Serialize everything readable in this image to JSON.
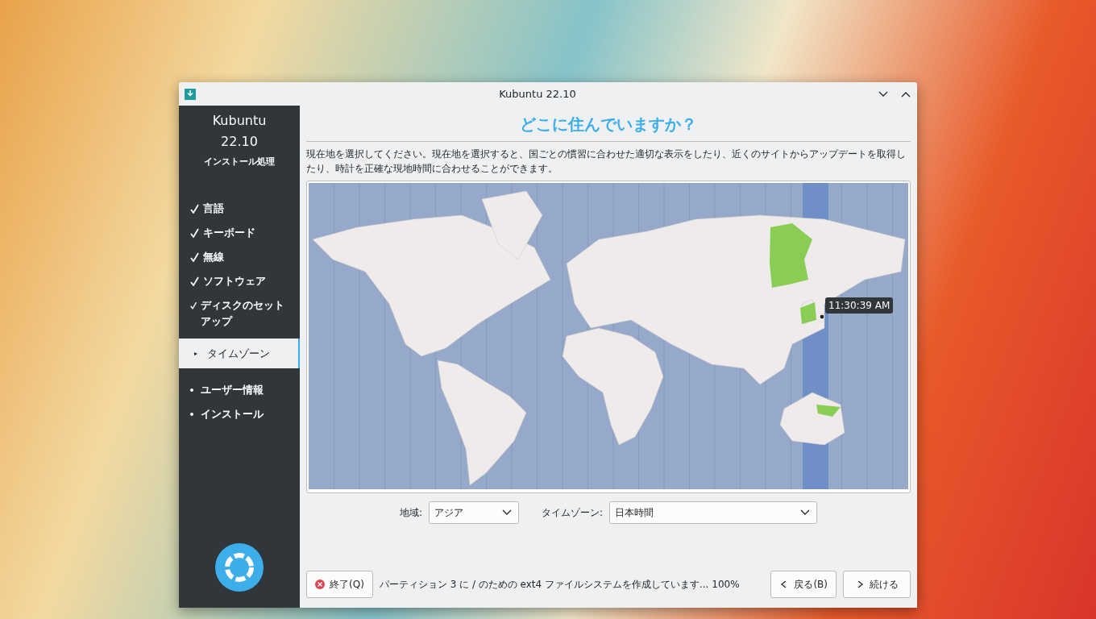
{
  "window": {
    "title": "Kubuntu 22.10"
  },
  "sidebar": {
    "brand": "Kubuntu",
    "version": "22.10",
    "subtitle": "インストール処理",
    "steps": [
      {
        "label": "言語",
        "kind": "done",
        "selected": false
      },
      {
        "label": "キーボード",
        "kind": "done",
        "selected": false
      },
      {
        "label": "無線",
        "kind": "done",
        "selected": false
      },
      {
        "label": "ソフトウェア",
        "kind": "done",
        "selected": false
      },
      {
        "label": "ディスクのセットアップ",
        "kind": "done",
        "selected": false
      },
      {
        "label": "タイムゾーン",
        "kind": "current",
        "selected": true
      },
      {
        "label": "ユーザー情報",
        "kind": "pending",
        "selected": false
      },
      {
        "label": "インストール",
        "kind": "pending",
        "selected": false
      }
    ]
  },
  "page": {
    "heading": "どこに住んでいますか？",
    "description": "現在地を選択してください。現在地を選択すると、国ごとの慣習に合わせた適切な表示をしたり、近くのサイトからアップデートを取得したり、時計を正確な現地時間に合わせることができます。"
  },
  "map": {
    "time_label": "11:30:39 AM"
  },
  "location": {
    "region_label": "地域:",
    "region_value": "アジア",
    "timezone_label": "タイムゾーン:",
    "timezone_value": "日本時間"
  },
  "footer": {
    "quit_button": "終了(Q)",
    "status": "パーティション 3 に / のための ext4 ファイルシステムを作成しています... 100%",
    "back_button": "戻る(B)",
    "next_button": "続ける"
  }
}
